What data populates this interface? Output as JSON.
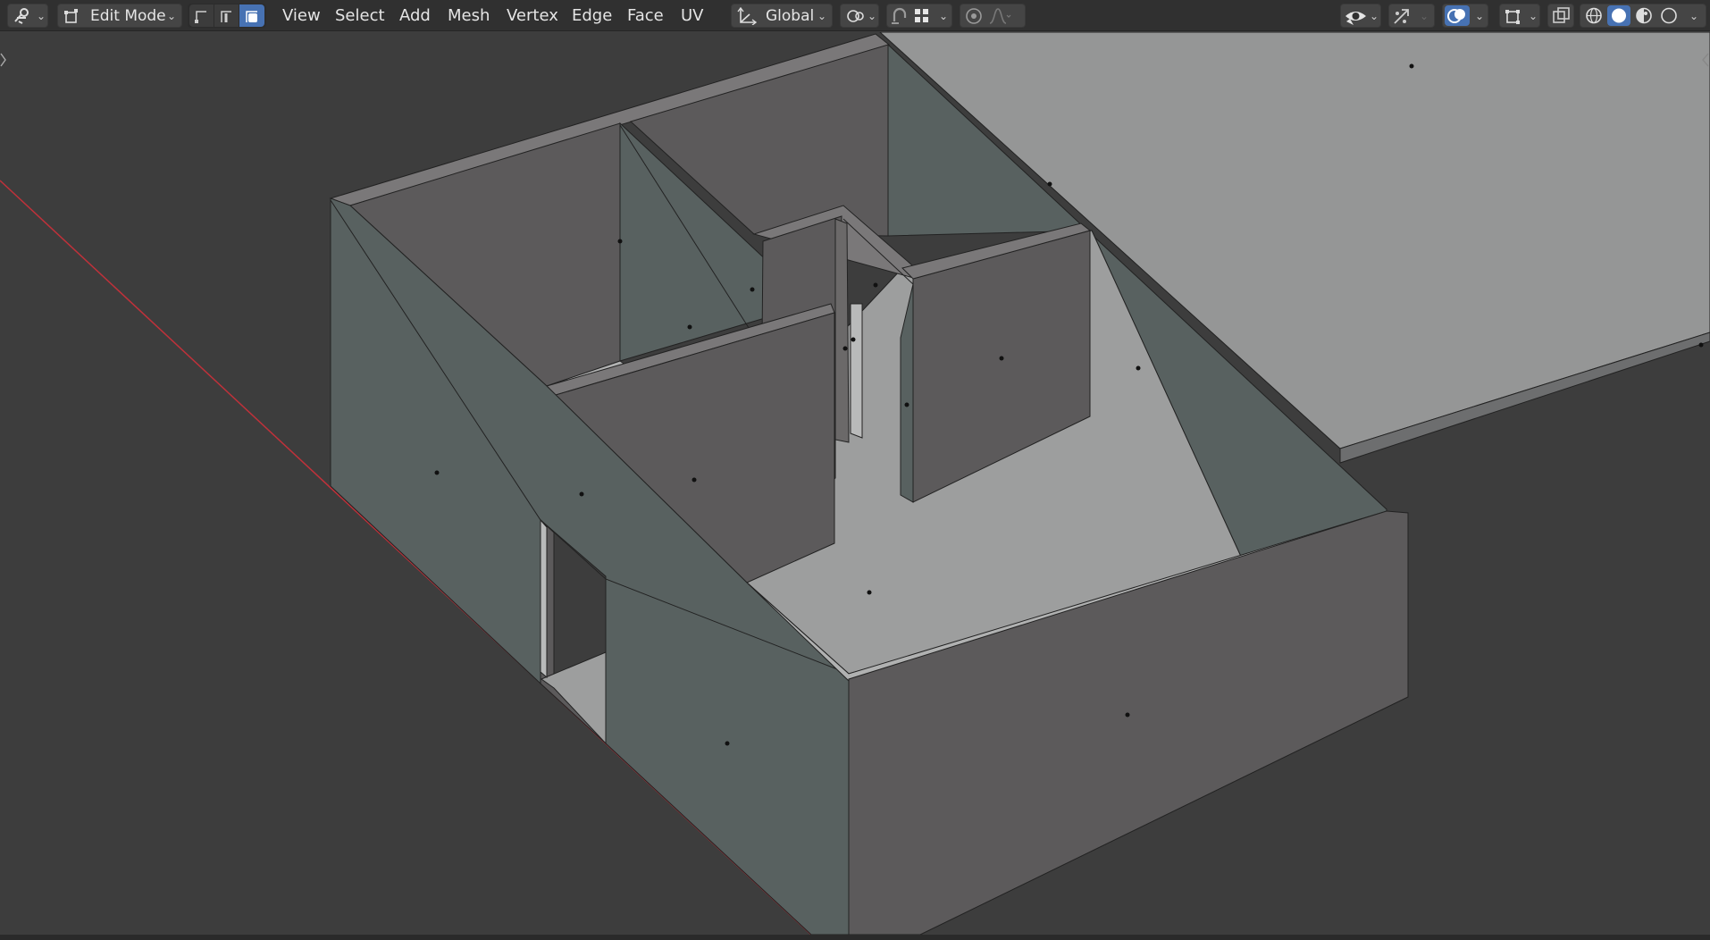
{
  "header": {
    "editor_type_icon": "editor-type-icon",
    "mode": {
      "icon": "edit-mode-icon",
      "label": "Edit Mode"
    },
    "select_modes": [
      {
        "name": "vertex-select-icon",
        "active": false
      },
      {
        "name": "edge-select-icon",
        "active": false
      },
      {
        "name": "face-select-icon",
        "active": true
      }
    ],
    "menus": [
      "View",
      "Select",
      "Add",
      "Mesh",
      "Vertex",
      "Edge",
      "Face",
      "UV"
    ],
    "transform_orientation": {
      "icon": "transform-orientation-icon",
      "label": "Global"
    },
    "pivot_icon": "pivot-point-icon",
    "snap_icons": [
      "snap-toggle-icon",
      "snap-increment-icon"
    ],
    "proportional_icons": [
      "proportional-edit-icon",
      "falloff-icon"
    ],
    "right_icons": [
      "visibility-icon",
      "gizmo-icon",
      "overlay-icon",
      "xray-icon"
    ],
    "shading_icons": [
      "wireframe-shading-icon",
      "solid-shading-icon",
      "material-shading-icon",
      "rendered-shading-icon"
    ],
    "accent_color": "#4772b3"
  },
  "viewport": {
    "background": "#3d3d3d",
    "x_axis_color": "#c0313a",
    "wall_dark": "#5c5a5b",
    "wall_teal": "#586160",
    "floor": "#9d9e9e",
    "slab": "#959696"
  }
}
